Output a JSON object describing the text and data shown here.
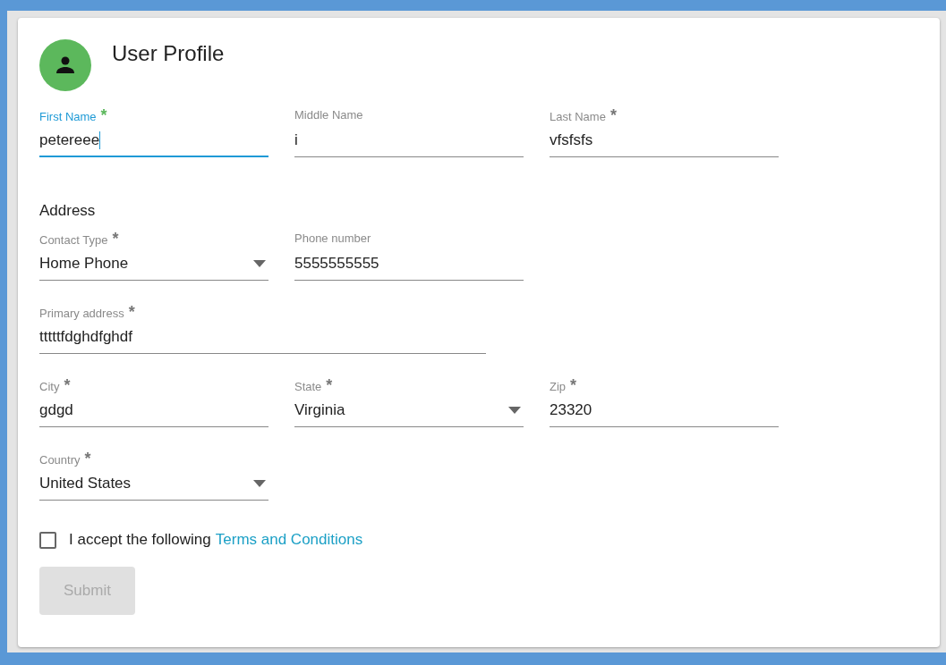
{
  "header": {
    "title": "User Profile"
  },
  "rows": [
    {
      "fields": [
        {
          "kind": "text",
          "label": "First Name",
          "mark": "*",
          "value": "petereee",
          "focused": true
        },
        {
          "kind": "text",
          "label": "Middle Name",
          "value": "i",
          "focused": false
        },
        {
          "kind": "text",
          "label": "Last Name",
          "mark": "*",
          "value": "vfsfsfs",
          "focused": false
        }
      ]
    },
    {
      "heading": "Address",
      "fields": [
        {
          "kind": "select",
          "label": "Contact Type",
          "mark": "*",
          "value": "Home Phone",
          "focused": false
        },
        {
          "kind": "text",
          "label": "Phone number",
          "value": "5555555555",
          "focused": false
        }
      ]
    },
    {
      "fields": [
        {
          "kind": "text",
          "wide": true,
          "label": "Primary address",
          "mark": "*",
          "value": "tttttfdghdfghdf",
          "focused": false
        }
      ]
    },
    {
      "fields": [
        {
          "kind": "text",
          "label": "City",
          "mark": "*",
          "value": "gdgd",
          "focused": false
        },
        {
          "kind": "select",
          "label": "State",
          "mark": "*",
          "value": "Virginia",
          "focused": false
        },
        {
          "kind": "text",
          "label": "Zip",
          "mark": "*",
          "value": "23320",
          "focused": false
        }
      ]
    },
    {
      "fields": [
        {
          "kind": "select",
          "label": "Country",
          "mark": "*",
          "value": "United States",
          "focused": false
        }
      ]
    }
  ],
  "terms": {
    "checked": false,
    "text": "I accept the following",
    "link": "Terms and Conditions"
  },
  "submit": {
    "label": "Submit",
    "disabled": true
  }
}
